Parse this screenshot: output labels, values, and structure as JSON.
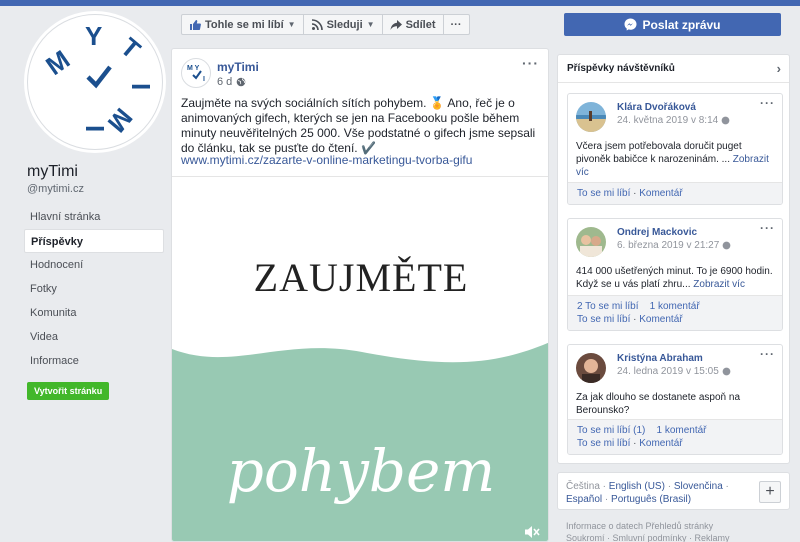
{
  "colors": {
    "accent": "#4267b2",
    "green": "#42b72a",
    "mint": "#98c9b3"
  },
  "page": {
    "name": "myTimi",
    "handle": "@mytimi.cz",
    "logo_letters": [
      "M",
      "Y",
      "T",
      "I",
      "M",
      "I"
    ]
  },
  "leftnav": {
    "items": [
      "Hlavní stránka",
      "Příspěvky",
      "Hodnocení",
      "Fotky",
      "Komunita",
      "Videa",
      "Informace"
    ],
    "active": "Příspěvky",
    "create_button": "Vytvořit stránku"
  },
  "actionbar": {
    "like": "Tohle se mi líbí",
    "follow": "Sleduji",
    "share": "Sdílet",
    "more": "···",
    "send_message": "Poslat zprávu"
  },
  "post": {
    "author": "myTimi",
    "time": "6 d",
    "more": "···",
    "text": "Zaujměte na svých sociálních sítích pohybem. 🏅 Ano, řeč je o animovaných gifech, kterých se jen na Facebooku pošle během minuty neuvěřitelných 25 000. Vše podstatné o gifech jsme sepsali do článku, tak se pusťte do čtení. ✔️",
    "link": "www.mytimi.cz/zazarte-v-online-marketingu-tvorba-gifu",
    "image_headline": "ZAUJMĚTE",
    "image_script": "pohybem"
  },
  "visitors": {
    "title": "Příspěvky návštěvníků",
    "posts": [
      {
        "name": "Klára Dvořáková",
        "date": "24. května 2019 v 8:14",
        "text": "Včera jsem potřebovala doručit puget pivoněk babičce k narozeninám. ...",
        "more_link": "Zobrazit víc",
        "stats_likes": "",
        "stats_comments": "",
        "like": "To se mi líbí",
        "comment": "Komentář"
      },
      {
        "name": "Ondrej Mackovic",
        "date": "6. března 2019 v 21:27",
        "text": "414 000 ušetřených minut. To je 6900 hodin. Když se u vás platí zhru...",
        "more_link": "Zobrazit víc",
        "stats_likes": "2 To se mi líbí",
        "stats_comments": "1 komentář",
        "like": "To se mi líbí",
        "comment": "Komentář"
      },
      {
        "name": "Kristýna Abraham",
        "date": "24. ledna 2019 v 15:05",
        "text": "Za jak dlouho se dostanete aspoň na Berounsko?",
        "more_link": "",
        "stats_likes": "To se mi líbí (1)",
        "stats_comments": "1 komentář",
        "like": "To se mi líbí",
        "comment": "Komentář"
      }
    ]
  },
  "languages": {
    "current": "Čeština",
    "others": [
      "English (US)",
      "Slovenčina",
      "Español",
      "Português (Brasil)"
    ],
    "add": "+"
  },
  "footer": {
    "line1": "Informace o datech Přehledů stránky",
    "line2": "Soukromí · Smluvní podmínky · Reklamy"
  }
}
